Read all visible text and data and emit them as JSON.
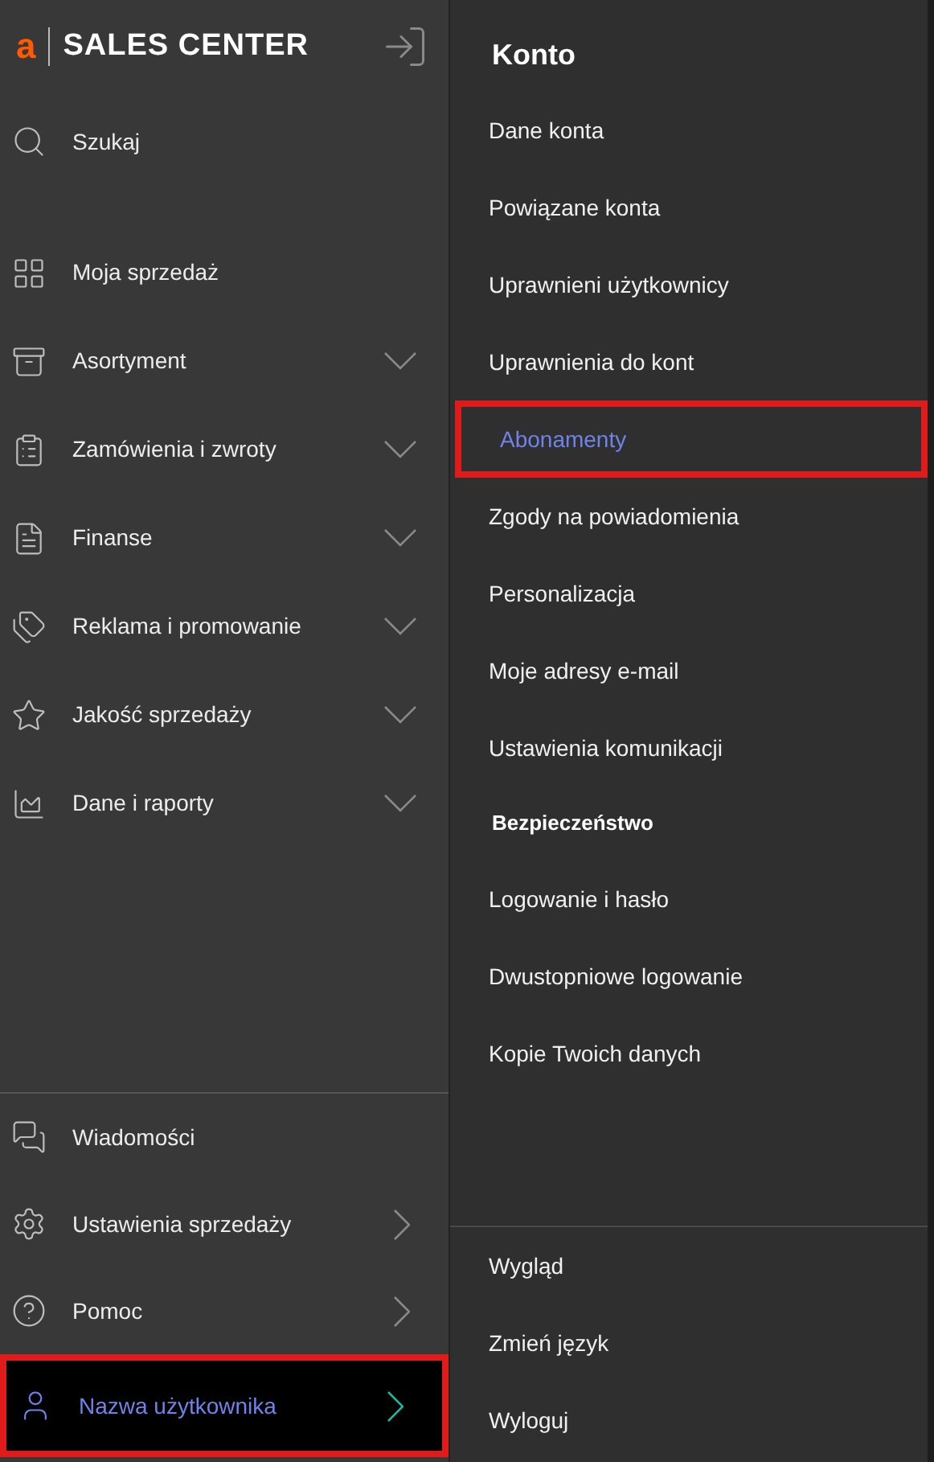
{
  "sidebar": {
    "logo": {
      "mark": "a",
      "text": "SALES CENTER"
    },
    "search": {
      "label": "Szukaj"
    },
    "items": [
      {
        "label": "Moja sprzedaż",
        "kind": "link"
      },
      {
        "label": "Asortyment",
        "kind": "group"
      },
      {
        "label": "Zamówienia i zwroty",
        "kind": "group"
      },
      {
        "label": "Finanse",
        "kind": "group"
      },
      {
        "label": "Reklama i promowanie",
        "kind": "group"
      },
      {
        "label": "Jakość sprzedaży",
        "kind": "group"
      },
      {
        "label": "Dane i raporty",
        "kind": "group"
      }
    ],
    "bottom_items": [
      {
        "label": "Wiadomości",
        "kind": "link",
        "selected": false,
        "highlighted": false
      },
      {
        "label": "Ustawienia sprzedaży",
        "kind": "submenu",
        "selected": false,
        "highlighted": false
      },
      {
        "label": "Pomoc",
        "kind": "submenu",
        "selected": false,
        "highlighted": false
      },
      {
        "label": "Nazwa użytkownika",
        "kind": "submenu",
        "selected": true,
        "highlighted": true
      }
    ]
  },
  "account_menu": {
    "title": "Konto",
    "items": [
      {
        "label": "Dane konta",
        "selected": false,
        "highlighted": false
      },
      {
        "label": "Powiązane konta",
        "selected": false,
        "highlighted": false
      },
      {
        "label": "Uprawnieni użytkownicy",
        "selected": false,
        "highlighted": false
      },
      {
        "label": "Uprawnienia do kont",
        "selected": false,
        "highlighted": false
      },
      {
        "label": "Abonamenty",
        "selected": true,
        "highlighted": true
      },
      {
        "label": "Zgody na powiadomienia",
        "selected": false,
        "highlighted": false
      },
      {
        "label": "Personalizacja",
        "selected": false,
        "highlighted": false
      },
      {
        "label": "Moje adresy e-mail",
        "selected": false,
        "highlighted": false
      },
      {
        "label": "Ustawienia komunikacji",
        "selected": false,
        "highlighted": false
      }
    ],
    "security_title": "Bezpieczeństwo",
    "security_items": [
      {
        "label": "Logowanie i hasło",
        "selected": false,
        "highlighted": false
      },
      {
        "label": "Dwustopniowe logowanie",
        "selected": false,
        "highlighted": false
      },
      {
        "label": "Kopie Twoich danych",
        "selected": false,
        "highlighted": false
      }
    ],
    "footer_items": [
      {
        "label": "Wygląd",
        "selected": false,
        "highlighted": false
      },
      {
        "label": "Zmień język",
        "selected": false,
        "highlighted": false
      },
      {
        "label": "Wyloguj",
        "selected": false,
        "highlighted": false
      }
    ]
  }
}
